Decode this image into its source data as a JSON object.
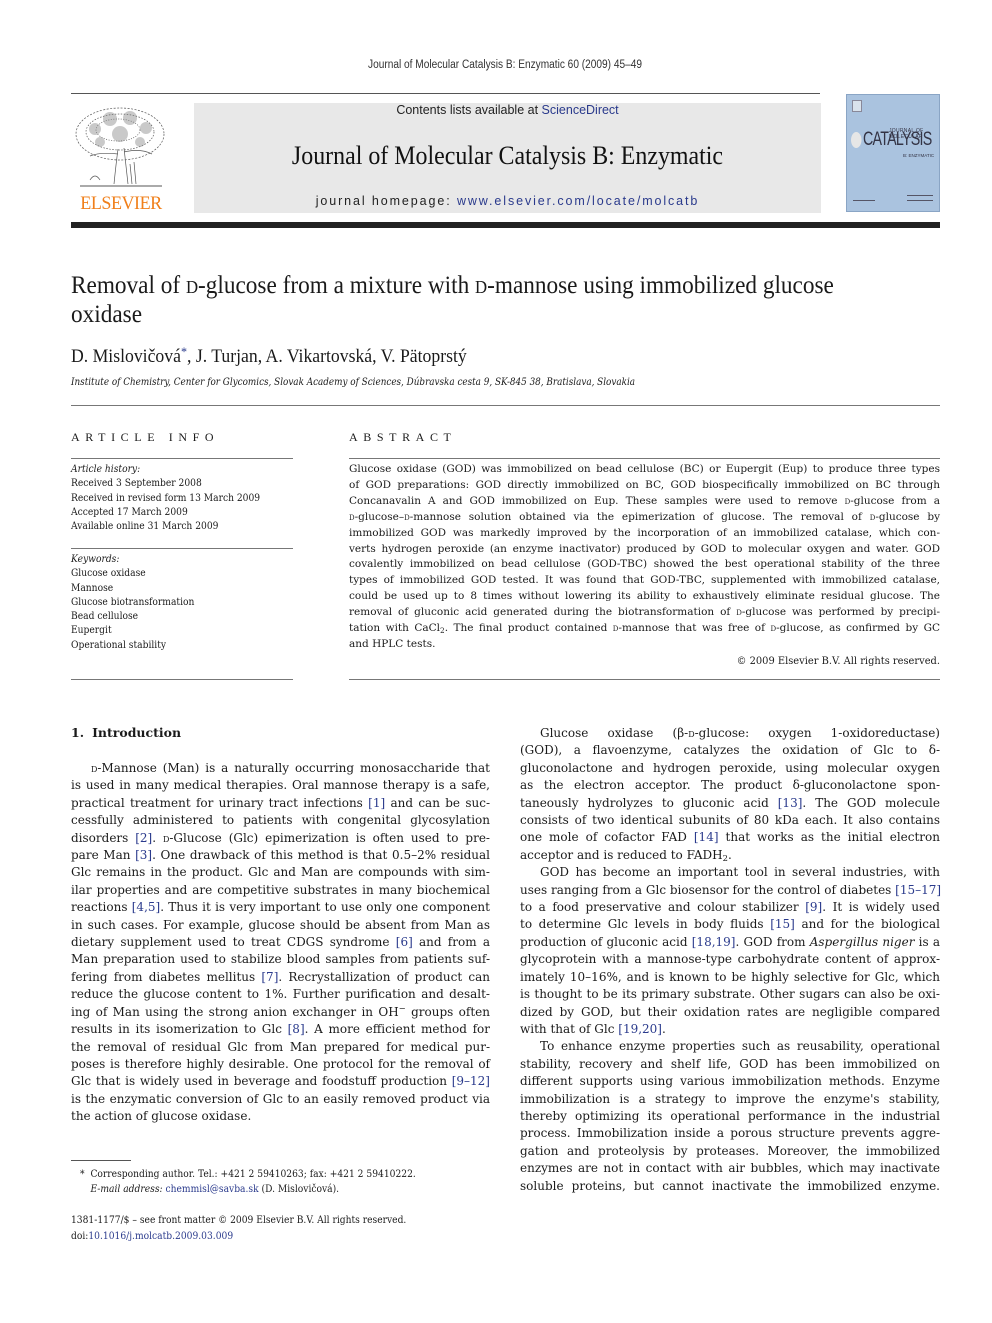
{
  "running_head": "Journal of Molecular Catalysis B: Enzymatic 60 (2009) 45–49",
  "masthead": {
    "contents_prefix": "Contents lists available at ",
    "contents_link": "ScienceDirect",
    "journal_title": "Journal of Molecular Catalysis B: Enzymatic",
    "homepage_prefix": "journal homepage: ",
    "homepage_link": "www.elsevier.com/locate/molcatb",
    "publisher_logo_text": "ELSEVIER",
    "publisher_color": "#f07f1a",
    "cover": {
      "series": "JOURNAL OF MOLECULAR",
      "title": "CATALYSIS",
      "subtitle": "B: ENZYMATIC",
      "color": "#aac3df"
    }
  },
  "article": {
    "title_parts": [
      "Removal of ",
      "d",
      "-glucose from a mixture with ",
      "d",
      "-mannose using immobilized glucose oxidase"
    ],
    "authors": {
      "first": "D. Mislovičová",
      "corresponding_mark": "*",
      "rest": ", J. Turjan, A. Vikartovská, V. Pätoprstý"
    },
    "affiliation": "Institute of Chemistry, Center for Glycomics, Slovak Academy of Sciences, Dúbravska cesta 9, SK-845 38, Bratislava, Slovakia"
  },
  "article_info": {
    "heading": "ARTICLE INFO",
    "history_label": "Article history:",
    "history": [
      "Received 3 September 2008",
      "Received in revised form 13 March 2009",
      "Accepted 17 March 2009",
      "Available online 31 March 2009"
    ],
    "keywords_label": "Keywords:",
    "keywords": [
      "Glucose oxidase",
      "Mannose",
      "Glucose biotransformation",
      "Bead cellulose",
      "Eupergit",
      "Operational stability"
    ]
  },
  "abstract": {
    "heading": "ABSTRACT",
    "lines": [
      "Glucose oxidase (GOD) was immobilized on bead cellulose (BC) or Eupergit (Eup) to produce three types",
      "of GOD preparations: GOD directly immobilized on BC, GOD biospecifically immobilized on BC through",
      "Concanavalin A and GOD immobilized on Eup. These samples were used to remove D-glucose from a",
      "D-glucose–D-mannose solution obtained via the epimerization of glucose. The removal of D-glucose by",
      "immobilized GOD was markedly improved by the incorporation of an immobilized catalase, which con-",
      "verts hydrogen peroxide (an enzyme inactivator) produced by GOD to molecular oxygen and water. GOD",
      "covalently immobilized on bead cellulose (GOD-TBC) showed the best operational stability of the three",
      "types of immobilized GOD tested. It was found that GOD-TBC, supplemented with immobilized catalase,",
      "could be used up to 8 times without lowering its ability to exhaustively eliminate residual glucose. The",
      "removal of gluconic acid generated during the biotransformation of D-glucose was performed by precipi-",
      "tation with CaCl2. The final product contained D-mannose that was free of D-glucose, as confirmed by GC",
      "and HPLC tests."
    ],
    "copyright": "© 2009 Elsevier B.V. All rights reserved."
  },
  "introduction": {
    "number": "1.",
    "heading": "Introduction",
    "left_lines": [
      "D-Mannose (Man) is a naturally occurring monosaccharide that",
      "is used in many medical therapies. Oral mannose therapy is a safe,",
      "practical treatment for urinary tract infections [1] and can be suc-",
      "cessfully administered to patients with congenital glycosylation",
      "disorders [2]. D-Glucose (Glc) epimerization is often used to pre-",
      "pare Man [3]. One drawback of this method is that 0.5–2% residual",
      "Glc remains in the product. Glc and Man are compounds with sim-",
      "ilar properties and are competitive substrates in many biochemical",
      "reactions [4,5]. Thus it is very important to use only one component",
      "in such cases. For example, glucose should be absent from Man as",
      "dietary supplement used to treat CDGS syndrome [6] and from a",
      "Man preparation used to stabilize blood samples from patients suf-",
      "fering from diabetes mellitus [7]. Recrystallization of product can",
      "reduce the glucose content to 1%. Further purification and desalt-",
      "ing of Man using the strong anion exchanger in OH− groups often",
      "results in its isomerization to Glc [8]. A more efficient method for",
      "the removal of residual Glc from Man prepared for medical pur-",
      "poses is therefore highly desirable. One protocol for the removal of",
      "Glc that is widely used in beverage and foodstuff production [9–12]",
      "is the enzymatic conversion of Glc to an easily removed product via",
      "the action of glucose oxidase."
    ],
    "right_paragraphs": [
      [
        "Glucose oxidase (β-D-glucose: oxygen 1-oxidoreductase)",
        "(GOD), a flavoenzyme, catalyzes the oxidation of Glc to δ-",
        "gluconolactone and hydrogen peroxide, using molecular oxygen",
        "as the electron acceptor. The product δ-gluconolactone spon-",
        "taneously hydrolyzes to gluconic acid [13]. The GOD molecule",
        "consists of two identical subunits of 80 kDa each. It also contains",
        "one mole of cofactor FAD [14] that works as the initial electron",
        "acceptor and is reduced to FADH2."
      ],
      [
        "GOD has become an important tool in several industries, with",
        "uses ranging from a Glc biosensor for the control of diabetes [15–17]",
        "to a food preservative and colour stabilizer [9]. It is widely used",
        "to determine Glc levels in body fluids [15] and for the biological",
        "production of gluconic acid [18,19]. GOD from Aspergillus niger is a",
        "glycoprotein with a mannose-type carbohydrate content of approx-",
        "imately 10–16%, and is known to be highly selective for Glc, which",
        "is thought to be its primary substrate. Other sugars can also be oxi-",
        "dized by GOD, but their oxidation rates are negligible compared",
        "with that of Glc [19,20]."
      ],
      [
        "To enhance enzyme properties such as reusability, operational",
        "stability, recovery and shelf life, GOD has been immobilized on",
        "different supports using various immobilization methods. Enzyme",
        "immobilization is a strategy to improve the enzyme's stability,",
        "thereby optimizing its operational performance in the industrial",
        "process. Immobilization inside a porous structure prevents aggre-",
        "gation and proteolysis by proteases. Moreover, the immobilized",
        "enzymes are not in contact with air bubbles, which may inactivate",
        "soluble proteins, but cannot inactivate the immobilized enzyme."
      ]
    ]
  },
  "footnote": {
    "mark": "*",
    "text": "Corresponding author. Tel.: +421 2 59410263; fax: +421 2 59410222.",
    "email_label": "E-mail address:",
    "email": "chemmisl@savba.sk",
    "email_suffix": " (D. Mislovičová)."
  },
  "front_matter": {
    "issn_line": "1381-1177/$ – see front matter © 2009 Elsevier B.V. All rights reserved.",
    "doi_label": "doi:",
    "doi": "10.1016/j.molcatb.2009.03.009"
  },
  "link_color": "#2a3a8c"
}
